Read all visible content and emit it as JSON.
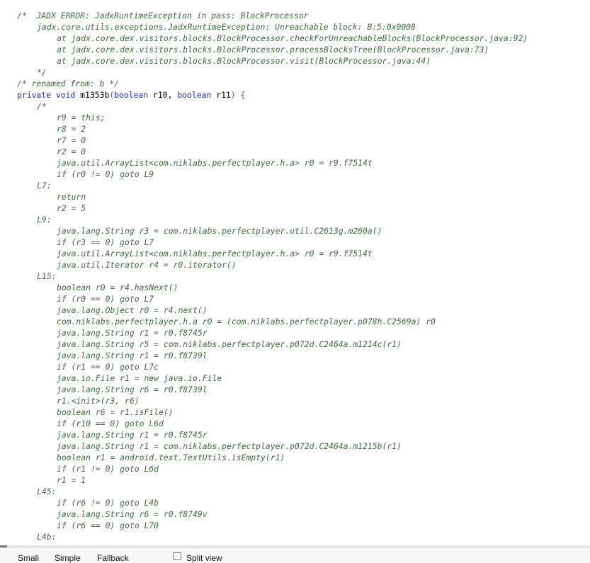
{
  "code_lines": [
    {
      "indent": 0,
      "style": "comment",
      "text": "/*  JADX ERROR: JadxRuntimeException in pass: BlockProcessor"
    },
    {
      "indent": 1,
      "style": "comment",
      "text": "jadx.core.utils.exceptions.JadxRuntimeException: Unreachable block: B:5:0x0008"
    },
    {
      "indent": 2,
      "style": "comment",
      "text": "at jadx.core.dex.visitors.blocks.BlockProcessor.checkForUnreachableBlocks(BlockProcessor.java:92)"
    },
    {
      "indent": 2,
      "style": "comment",
      "text": "at jadx.core.dex.visitors.blocks.BlockProcessor.processBlocksTree(BlockProcessor.java:73)"
    },
    {
      "indent": 2,
      "style": "comment",
      "text": "at jadx.core.dex.visitors.blocks.BlockProcessor.visit(BlockProcessor.java:44)"
    },
    {
      "indent": 1,
      "style": "comment",
      "text": "*/"
    },
    {
      "indent": 0,
      "style": "comment",
      "text": "/* renamed from: b */"
    },
    {
      "indent": 0,
      "style": "signature",
      "text": ""
    },
    {
      "indent": 1,
      "style": "comment",
      "text": "/*"
    },
    {
      "indent": 2,
      "style": "comment",
      "text": "r9 = this;"
    },
    {
      "indent": 2,
      "style": "comment",
      "text": "r8 = 2"
    },
    {
      "indent": 2,
      "style": "comment",
      "text": "r7 = 0"
    },
    {
      "indent": 2,
      "style": "comment",
      "text": "r2 = 0"
    },
    {
      "indent": 2,
      "style": "comment",
      "text": "java.util.ArrayList<com.niklabs.perfectplayer.h.a> r0 = r9.f7514t"
    },
    {
      "indent": 2,
      "style": "comment",
      "text": "if (r0 != 0) goto L9"
    },
    {
      "indent": 1,
      "style": "comment",
      "text": "L7:"
    },
    {
      "indent": 2,
      "style": "comment",
      "text": "return"
    },
    {
      "indent": 2,
      "style": "comment",
      "text": "r2 = 5"
    },
    {
      "indent": 1,
      "style": "comment",
      "text": "L9:"
    },
    {
      "indent": 2,
      "style": "comment",
      "text": "java.lang.String r3 = com.niklabs.perfectplayer.util.C2613g.m260a()"
    },
    {
      "indent": 2,
      "style": "comment",
      "text": "if (r3 == 0) goto L7"
    },
    {
      "indent": 2,
      "style": "comment",
      "text": "java.util.ArrayList<com.niklabs.perfectplayer.h.a> r0 = r9.f7514t"
    },
    {
      "indent": 2,
      "style": "comment",
      "text": "java.util.Iterator r4 = r0.iterator()"
    },
    {
      "indent": 1,
      "style": "comment",
      "text": "L15:"
    },
    {
      "indent": 2,
      "style": "comment",
      "text": "boolean r0 = r4.hasNext()"
    },
    {
      "indent": 2,
      "style": "comment",
      "text": "if (r0 == 0) goto L7"
    },
    {
      "indent": 2,
      "style": "comment",
      "text": "java.lang.Object r0 = r4.next()"
    },
    {
      "indent": 2,
      "style": "comment",
      "text": "com.niklabs.perfectplayer.h.a r0 = (com.niklabs.perfectplayer.p078h.C2569a) r0"
    },
    {
      "indent": 2,
      "style": "comment",
      "text": "java.lang.String r1 = r0.f8745r"
    },
    {
      "indent": 2,
      "style": "comment",
      "text": "java.lang.String r5 = com.niklabs.perfectplayer.p072d.C2464a.m1214c(r1)"
    },
    {
      "indent": 2,
      "style": "comment",
      "text": "java.lang.String r1 = r0.f8739l"
    },
    {
      "indent": 2,
      "style": "comment",
      "text": "if (r1 == 0) goto L7c"
    },
    {
      "indent": 2,
      "style": "comment",
      "text": "java.io.File r1 = new java.io.File"
    },
    {
      "indent": 2,
      "style": "comment",
      "text": "java.lang.String r6 = r0.f8739l"
    },
    {
      "indent": 2,
      "style": "comment",
      "text": "r1.<init>(r3, r6)"
    },
    {
      "indent": 2,
      "style": "comment",
      "text": "boolean r6 = r1.isFile()"
    },
    {
      "indent": 2,
      "style": "comment",
      "text": "if (r10 == 0) goto L6d"
    },
    {
      "indent": 2,
      "style": "comment",
      "text": "java.lang.String r1 = r0.f8745r"
    },
    {
      "indent": 2,
      "style": "comment",
      "text": "java.lang.String r1 = com.niklabs.perfectplayer.p072d.C2464a.m1215b(r1)"
    },
    {
      "indent": 2,
      "style": "comment",
      "text": "boolean r1 = android.text.TextUtils.isEmpty(r1)"
    },
    {
      "indent": 2,
      "style": "comment",
      "text": "if (r1 != 0) goto L6d"
    },
    {
      "indent": 2,
      "style": "comment",
      "text": "r1 = 1"
    },
    {
      "indent": 1,
      "style": "comment",
      "text": "L45:"
    },
    {
      "indent": 2,
      "style": "comment",
      "text": "if (r6 != 0) goto L4b"
    },
    {
      "indent": 2,
      "style": "comment",
      "text": "java.lang.String r6 = r0.f8749v"
    },
    {
      "indent": 2,
      "style": "comment",
      "text": "if (r6 == 0) goto L70"
    },
    {
      "indent": 1,
      "style": "comment",
      "text": "L4b:"
    }
  ],
  "signature": {
    "modifiers": "private void",
    "method_name": "m1353b",
    "open_paren": "(",
    "param1_type": "boolean",
    "param1_name": "r10,",
    "param2_type": "boolean",
    "param2_name": "r11",
    "close": ") {"
  },
  "bottom_bar": {
    "tabs": [
      "Smali",
      "Simple",
      "Fallback"
    ],
    "split_view_label": "Split view",
    "split_view_checked": false
  },
  "colors": {
    "comment": "#3a6e3a",
    "keyword": "#1a2bb0",
    "paren": "#c0392b"
  }
}
